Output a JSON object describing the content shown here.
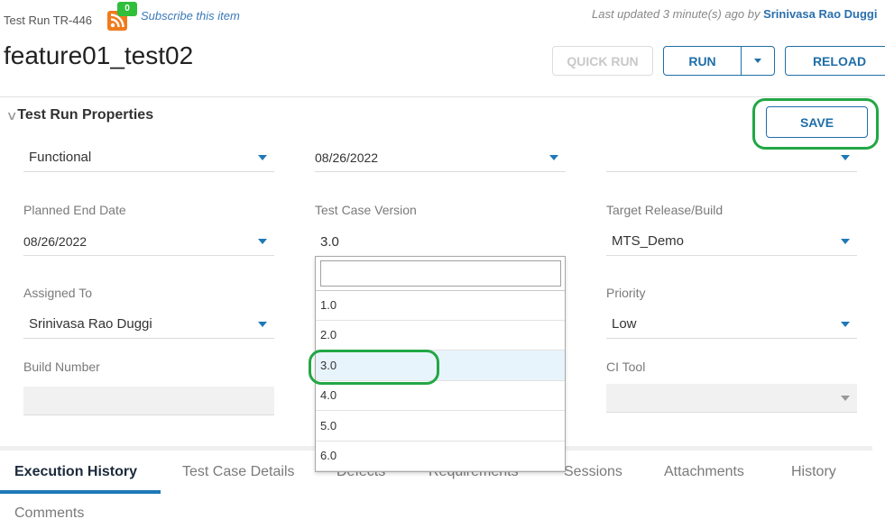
{
  "header": {
    "breadcrumb": "Test Run TR-446",
    "rss_icon": "rss-feed-icon",
    "subscriber_count": "0",
    "subscribe_label": "Subscribe this item",
    "last_updated_prefix": "Last updated 3 minute(s) ago by ",
    "last_updated_by": "Srinivasa Rao Duggi",
    "title": "feature01_test02"
  },
  "toolbar": {
    "quick_run_label": "QUICK RUN",
    "run_label": "RUN",
    "reload_label": "RELOAD",
    "save_label": "SAVE"
  },
  "section": {
    "title": "Test Run Properties",
    "chevron_icon": "chevron-down-icon"
  },
  "fields": {
    "type": {
      "value": "Functional"
    },
    "planned_start_date": {
      "value": "08/26/2022"
    },
    "unnamed_top_right": {
      "value": ""
    },
    "planned_end_date": {
      "label": "Planned End Date",
      "value": "08/26/2022"
    },
    "test_case_version": {
      "label": "Test Case Version",
      "value": "3.0"
    },
    "target_release": {
      "label": "Target Release/Build",
      "value": "MTS_Demo"
    },
    "assigned_to": {
      "label": "Assigned To",
      "value": "Srinivasa Rao Duggi"
    },
    "priority": {
      "label": "Priority",
      "value": "Low"
    },
    "build_number": {
      "label": "Build Number",
      "value": ""
    },
    "ci_tool": {
      "label": "CI Tool",
      "value": ""
    }
  },
  "version_dropdown": {
    "search_value": "",
    "options": [
      "1.0",
      "2.0",
      "3.0",
      "4.0",
      "5.0",
      "6.0"
    ],
    "selected": "3.0"
  },
  "tabs": [
    {
      "label": "Execution History",
      "active": true
    },
    {
      "label": "Test Case Details"
    },
    {
      "label": "Defects"
    },
    {
      "label": "Requirements"
    },
    {
      "label": "Sessions"
    },
    {
      "label": "Attachments"
    },
    {
      "label": "History"
    },
    {
      "label": "Comments"
    }
  ],
  "colors": {
    "accent": "#1f6ea8",
    "highlight": "#22a745",
    "rss": "#f07b1d",
    "badge": "#2fbf3a",
    "selected_option_bg": "#e8f4fc"
  }
}
